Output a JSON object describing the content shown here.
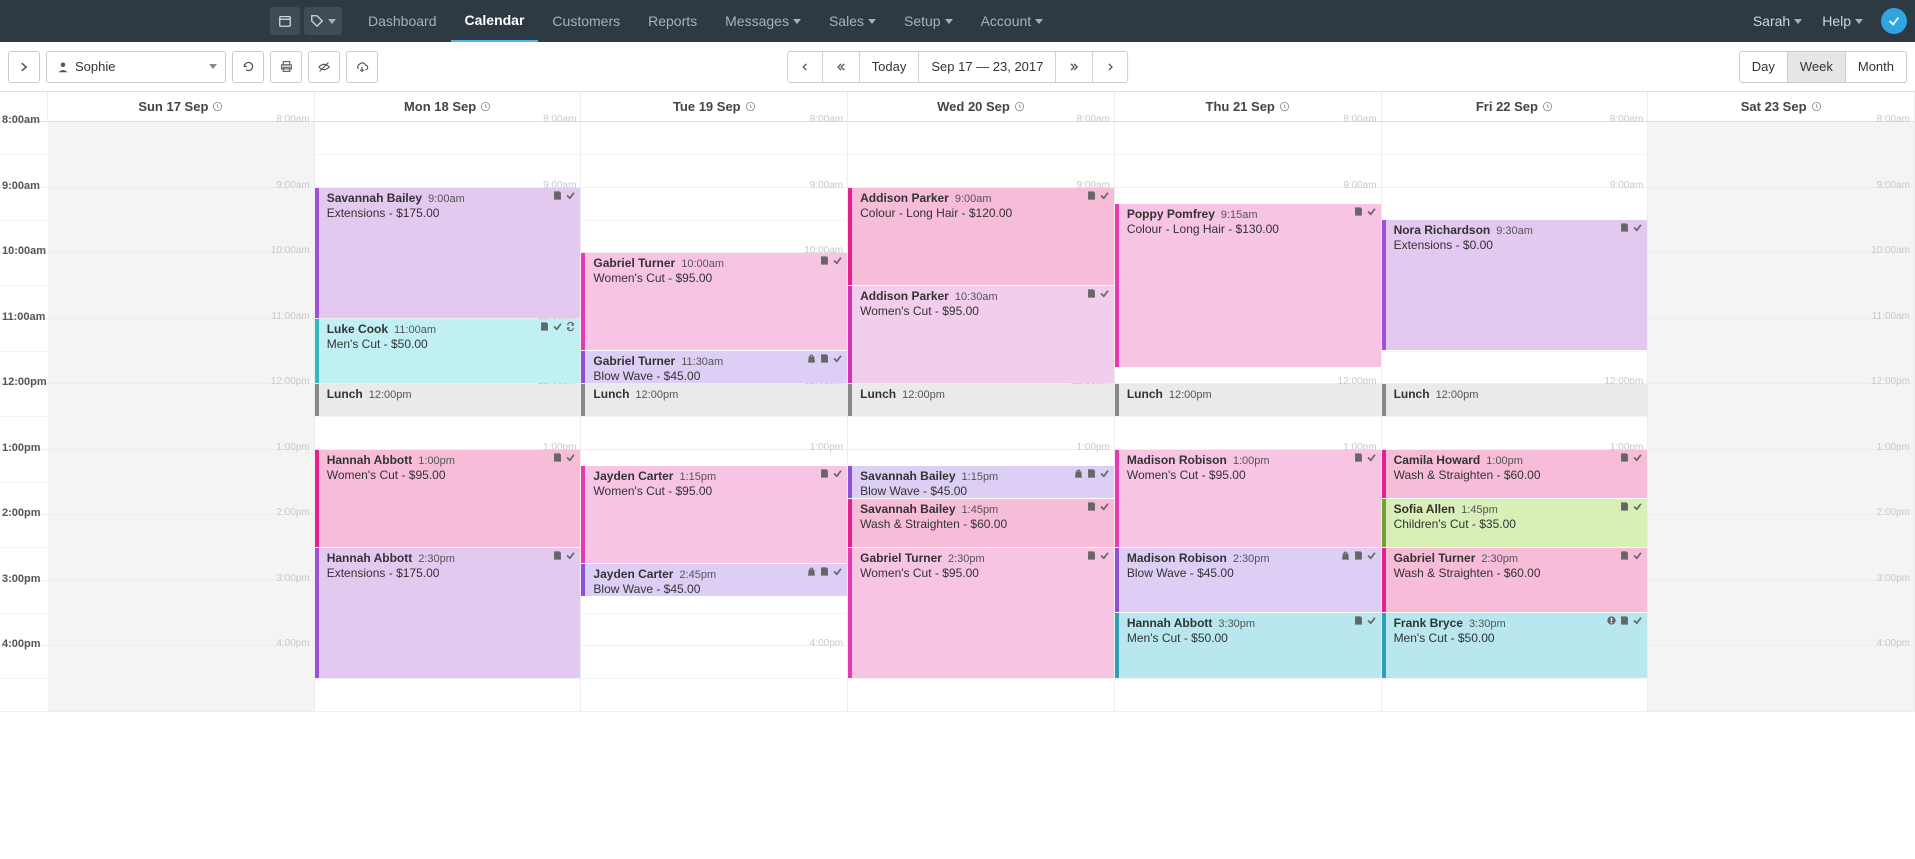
{
  "nav": {
    "items": [
      "Dashboard",
      "Calendar",
      "Customers",
      "Reports",
      "Messages",
      "Sales",
      "Setup",
      "Account"
    ],
    "active_index": 1,
    "dropdown_items": [
      4,
      5,
      6,
      7
    ],
    "user": "Sarah",
    "help": "Help"
  },
  "toolbar": {
    "staff": "Sophie",
    "today": "Today",
    "date_range": "Sep 17 — 23, 2017",
    "views": [
      "Day",
      "Week",
      "Month"
    ],
    "active_view": 1
  },
  "days": [
    {
      "label": "Sun 17 Sep",
      "off": true
    },
    {
      "label": "Mon 18 Sep"
    },
    {
      "label": "Tue 19 Sep"
    },
    {
      "label": "Wed 20 Sep"
    },
    {
      "label": "Thu 21 Sep"
    },
    {
      "label": "Fri 22 Sep"
    },
    {
      "label": "Sat 23 Sep",
      "off": true
    }
  ],
  "hours": [
    "8:00am",
    "9:00am",
    "10:00am",
    "11:00am",
    "12:00pm",
    "1:00pm",
    "2:00pm",
    "3:00pm",
    "4:00pm"
  ],
  "events": [
    {
      "day": 1,
      "start": 9,
      "dur": 2,
      "name": "Savannah Bailey",
      "time": "9:00am",
      "desc": "Extensions - $175.00",
      "color": "c-plum",
      "icons": [
        "note",
        "check"
      ]
    },
    {
      "day": 1,
      "start": 11,
      "dur": 1,
      "name": "Luke Cook",
      "time": "11:00am",
      "desc": "Men's Cut - $50.00",
      "color": "c-cyan",
      "icons": [
        "note",
        "check",
        "repeat"
      ]
    },
    {
      "day": 1,
      "start": 12,
      "dur": 0.5,
      "name": "Lunch",
      "time": "12:00pm",
      "desc": "",
      "color": "c-grey",
      "icons": []
    },
    {
      "day": 1,
      "start": 13,
      "dur": 1.5,
      "name": "Hannah Abbott",
      "time": "1:00pm",
      "desc": "Women's Cut - $95.00",
      "color": "c-hotpink",
      "icons": [
        "note",
        "check"
      ]
    },
    {
      "day": 1,
      "start": 14.5,
      "dur": 2,
      "name": "Hannah Abbott",
      "time": "2:30pm",
      "desc": "Extensions - $175.00",
      "color": "c-plum",
      "icons": [
        "note",
        "check"
      ]
    },
    {
      "day": 2,
      "start": 10,
      "dur": 1.5,
      "name": "Gabriel Turner",
      "time": "10:00am",
      "desc": "Women's Cut - $95.00",
      "color": "c-pink",
      "icons": [
        "note",
        "check"
      ]
    },
    {
      "day": 2,
      "start": 11.5,
      "dur": 0.5,
      "name": "Gabriel Turner",
      "time": "11:30am",
      "desc": "Blow Wave - $45.00",
      "color": "c-lav",
      "icons": [
        "bag",
        "note",
        "check"
      ]
    },
    {
      "day": 2,
      "start": 12,
      "dur": 0.5,
      "name": "Lunch",
      "time": "12:00pm",
      "desc": "",
      "color": "c-grey",
      "icons": []
    },
    {
      "day": 2,
      "start": 13.25,
      "dur": 1.5,
      "name": "Jayden Carter",
      "time": "1:15pm",
      "desc": "Women's Cut - $95.00",
      "color": "c-pink",
      "icons": [
        "note",
        "check"
      ]
    },
    {
      "day": 2,
      "start": 14.75,
      "dur": 0.5,
      "name": "Jayden Carter",
      "time": "2:45pm",
      "desc": "Blow Wave - $45.00",
      "color": "c-lav",
      "icons": [
        "bag",
        "note",
        "check"
      ]
    },
    {
      "day": 3,
      "start": 9,
      "dur": 1.5,
      "name": "Addison Parker",
      "time": "9:00am",
      "desc": "Colour - Long Hair - $120.00",
      "color": "c-hotpink",
      "icons": [
        "note",
        "check"
      ]
    },
    {
      "day": 3,
      "start": 10.5,
      "dur": 1.5,
      "name": "Addison Parker",
      "time": "10:30am",
      "desc": "Women's Cut - $95.00",
      "color": "c-magenta",
      "icons": [
        "note",
        "check"
      ]
    },
    {
      "day": 3,
      "start": 12,
      "dur": 0.5,
      "name": "Lunch",
      "time": "12:00pm",
      "desc": "",
      "color": "c-grey",
      "icons": []
    },
    {
      "day": 3,
      "start": 13.25,
      "dur": 0.5,
      "name": "Savannah Bailey",
      "time": "1:15pm",
      "desc": "Blow Wave - $45.00",
      "color": "c-lav",
      "icons": [
        "bag",
        "note",
        "check"
      ]
    },
    {
      "day": 3,
      "start": 13.75,
      "dur": 0.75,
      "name": "Savannah Bailey",
      "time": "1:45pm",
      "desc": "Wash & Straighten - $60.00",
      "color": "c-hotpink",
      "icons": [
        "note",
        "check"
      ]
    },
    {
      "day": 3,
      "start": 14.5,
      "dur": 2,
      "name": "Gabriel Turner",
      "time": "2:30pm",
      "desc": "Women's Cut - $95.00",
      "color": "c-pink",
      "icons": [
        "note",
        "check"
      ]
    },
    {
      "day": 4,
      "start": 9.25,
      "dur": 2.5,
      "name": "Poppy Pomfrey",
      "time": "9:15am",
      "desc": "Colour - Long Hair - $130.00",
      "color": "c-pink",
      "icons": [
        "note",
        "check"
      ]
    },
    {
      "day": 4,
      "start": 12,
      "dur": 0.5,
      "name": "Lunch",
      "time": "12:00pm",
      "desc": "",
      "color": "c-grey",
      "icons": []
    },
    {
      "day": 4,
      "start": 13,
      "dur": 1.5,
      "name": "Madison Robison",
      "time": "1:00pm",
      "desc": "Women's Cut - $95.00",
      "color": "c-pink",
      "icons": [
        "note",
        "check"
      ]
    },
    {
      "day": 4,
      "start": 14.5,
      "dur": 1,
      "name": "Madison Robison",
      "time": "2:30pm",
      "desc": "Blow Wave - $45.00",
      "color": "c-lav",
      "icons": [
        "bag",
        "note",
        "check"
      ]
    },
    {
      "day": 4,
      "start": 15.5,
      "dur": 1,
      "name": "Hannah Abbott",
      "time": "3:30pm",
      "desc": "Men's Cut - $50.00",
      "color": "c-teal",
      "icons": [
        "note",
        "check"
      ]
    },
    {
      "day": 5,
      "start": 9.5,
      "dur": 2,
      "name": "Nora Richardson",
      "time": "9:30am",
      "desc": "Extensions - $0.00",
      "color": "c-plum",
      "icons": [
        "note",
        "check"
      ]
    },
    {
      "day": 5,
      "start": 12,
      "dur": 0.5,
      "name": "Lunch",
      "time": "12:00pm",
      "desc": "",
      "color": "c-grey",
      "icons": []
    },
    {
      "day": 5,
      "start": 13,
      "dur": 0.75,
      "name": "Camila Howard",
      "time": "1:00pm",
      "desc": "Wash & Straighten - $60.00",
      "color": "c-hotpink",
      "icons": [
        "note",
        "check"
      ]
    },
    {
      "day": 5,
      "start": 13.75,
      "dur": 0.75,
      "name": "Sofia Allen",
      "time": "1:45pm",
      "desc": "Children's Cut - $35.00",
      "color": "c-green",
      "icons": [
        "note",
        "check"
      ]
    },
    {
      "day": 5,
      "start": 14.5,
      "dur": 1,
      "name": "Gabriel Turner",
      "time": "2:30pm",
      "desc": "Wash & Straighten - $60.00",
      "color": "c-hotpink",
      "icons": [
        "note",
        "check"
      ]
    },
    {
      "day": 5,
      "start": 15.5,
      "dur": 1,
      "name": "Frank Bryce",
      "time": "3:30pm",
      "desc": "Men's Cut - $50.00",
      "color": "c-teal",
      "icons": [
        "alert",
        "note",
        "check"
      ]
    }
  ]
}
